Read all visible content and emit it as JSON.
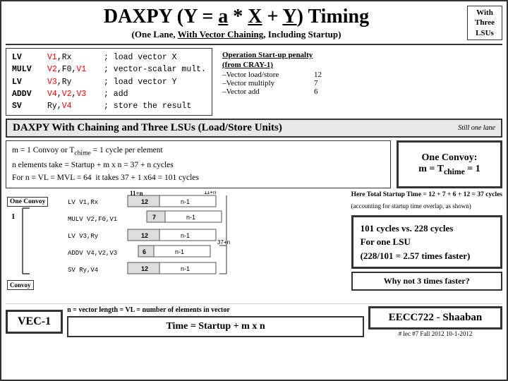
{
  "header": {
    "title_prefix": "DAXPY (Y = ",
    "title_a": "a",
    "title_suffix": " * X + Y) Timing",
    "subtitle": "(One Lane, With Vector Chaining, Including Startup)",
    "side_box": [
      "With",
      "Three",
      "LSUs"
    ]
  },
  "code_table": {
    "rows": [
      {
        "instr": "LV",
        "operands": "V1,Rx",
        "comment": "; load vector X",
        "red_parts": []
      },
      {
        "instr": "MULV",
        "operands": "V2,F0,V1",
        "comment": "; vector-scalar mult.",
        "red_parts": [
          "V2",
          "V1"
        ]
      },
      {
        "instr": "LV",
        "operands": "V3,Ry",
        "comment": "; load vector Y",
        "red_parts": [
          "V3"
        ]
      },
      {
        "instr": "ADDV",
        "operands": "V4,V2,V3",
        "comment": "; add",
        "red_parts": [
          "V4",
          "V2",
          "V3"
        ]
      },
      {
        "instr": "SV",
        "operands": "Ry,V4",
        "comment": "; store the result",
        "red_parts": [
          "V4"
        ]
      }
    ]
  },
  "operation": {
    "title": "Operation Start-up penalty",
    "subtitle": "(from CRAY-1)",
    "rows": [
      {
        "label": "–Vector load/store",
        "value": "12"
      },
      {
        "label": "–Vector multiply",
        "value": "7"
      },
      {
        "label": "–Vector add",
        "value": "6"
      }
    ]
  },
  "section_header": "DAXPY With Chaining and Three LSUs (Load/Store Units)",
  "still_one_lane": "Still one lane",
  "convoy_text": {
    "line1": "m = 1 Convoy or Tₜᴄʰᵐᵉ = 1 cycle per element",
    "line2": "n elements take = Startup + m x n = 37 + n cycles",
    "line3": "For n = VL = MVL = 64  it takes 37 + 1 x64 = 101 cycles"
  },
  "one_convoy_box": {
    "line1": "One Convoy:",
    "line2": "m = T",
    "line2_sub": "chime",
    "line2_end": " = 1"
  },
  "timing": {
    "startup_line": "Here Total Startup Time = 12 + 7 + 6 + 12 = 37 cycles",
    "overlap_line": "(accounting for startup time overlap, as shown)",
    "rows": [
      {
        "label": "LV  V1,Rx",
        "start": 0,
        "width12": 60,
        "widthN1": 100,
        "top_label": "12",
        "n1_label": "n-1"
      },
      {
        "label": "MULV  V2,F0,V1",
        "start": 35,
        "width12": 35,
        "widthN1": 100,
        "top_label": "7",
        "n1_label": "n-1"
      },
      {
        "label": "LV  V3,Ry",
        "start": 0,
        "width12": 60,
        "widthN1": 100,
        "top_label": "12",
        "n1_label": "n-1"
      },
      {
        "label": "ADDV  V4,V2,V3",
        "start": 10,
        "width12": 30,
        "widthN1": 100,
        "top_label": "6",
        "n1_label": "n-1"
      },
      {
        "label": "SV  Ry,V4",
        "start": 0,
        "width12": 60,
        "widthN1": 100,
        "top_label": "12",
        "n1_label": "n-1"
      }
    ],
    "top_11n": "11+n",
    "top_37n": "37+n"
  },
  "convoy_labels": {
    "one_convoy": "One Convoy",
    "convoy": "Convoy",
    "number": "1"
  },
  "cycles_box": {
    "line1": "101 cycles vs. 228 cycles",
    "line2": "For one LSU",
    "line3": "(228/101 = 2.57 times faster)"
  },
  "why_box": "Why not 3 times faster?",
  "n_definition": "n = vector length = VL = number of elements in vector",
  "vec1": "VEC-1",
  "time_formula": "Time = Startup + m x n",
  "eecc": "EECC722 - Shaaban",
  "footer": "# lec #7   Fall 2012   10-1-2012"
}
